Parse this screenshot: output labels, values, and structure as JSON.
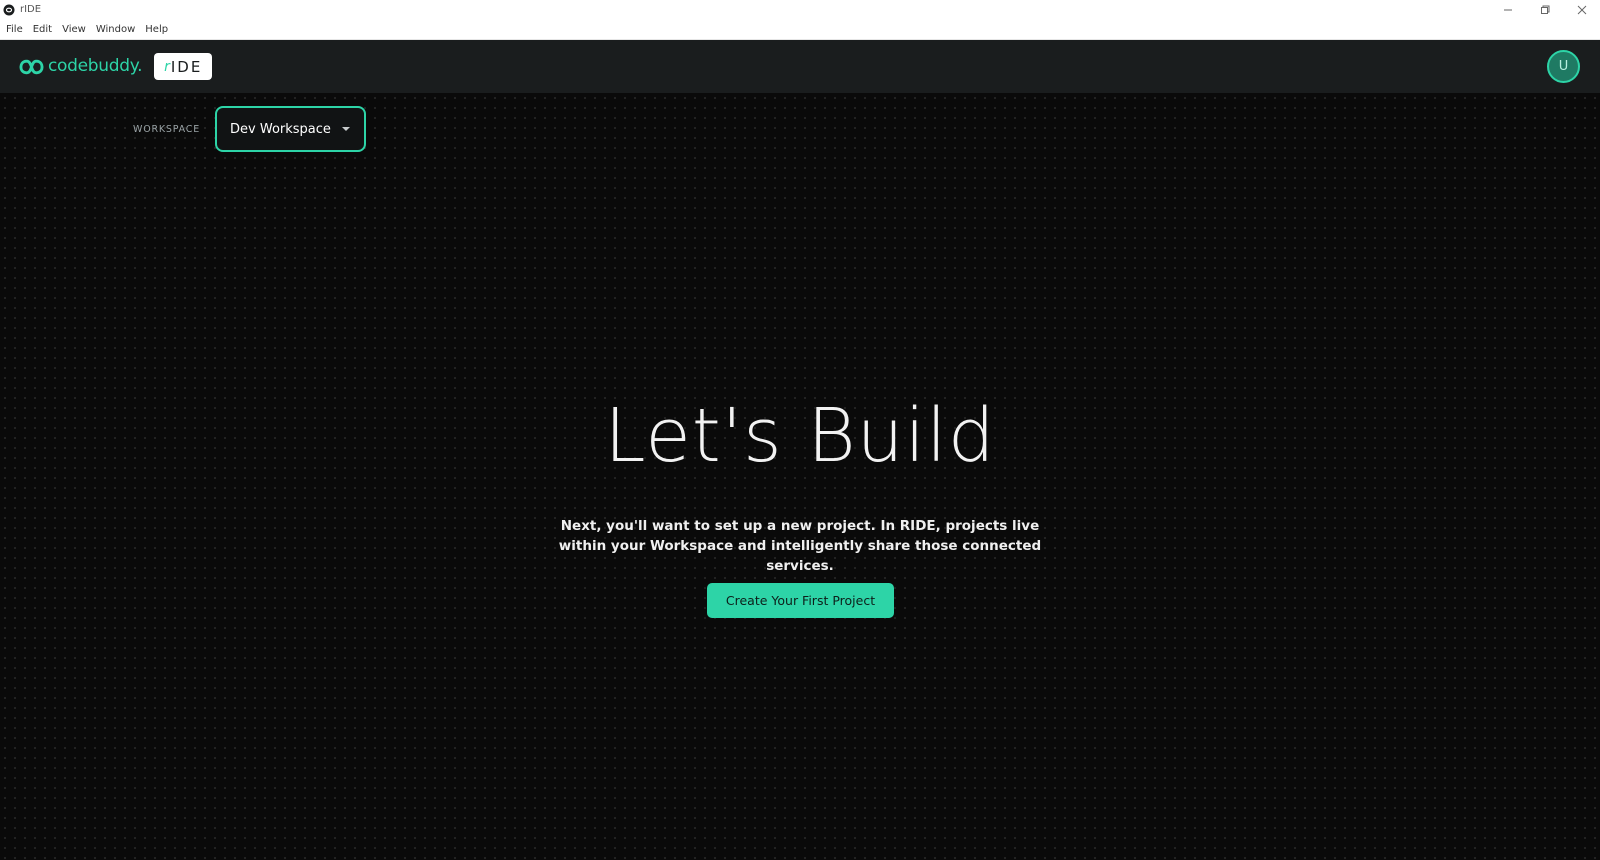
{
  "window": {
    "title": "rIDE",
    "controls": [
      "minimize-icon",
      "restore-icon",
      "close-icon"
    ]
  },
  "menubar": {
    "items": [
      "File",
      "Edit",
      "View",
      "Window",
      "Help"
    ]
  },
  "header": {
    "brand_name": "codebuddy.",
    "product_badge": "IDE",
    "avatar_initial": "U",
    "accent_color": "#2dd4a7"
  },
  "workspace": {
    "label": "WORKSPACE",
    "selected": "Dev Workspace"
  },
  "hero": {
    "title": "Let's Build",
    "subtitle": "Next, you'll want to set up a new project. In RIDE, projects live within your Workspace and intelligently share those connected services.",
    "cta_label": "Create Your First Project"
  }
}
